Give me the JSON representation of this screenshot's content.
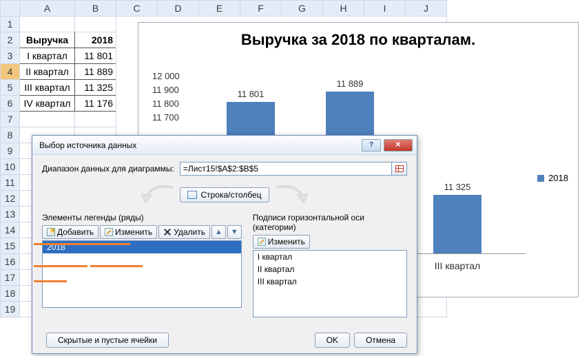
{
  "sheet": {
    "cols": [
      "A",
      "B",
      "C",
      "D",
      "E",
      "F",
      "G",
      "H",
      "I",
      "J"
    ],
    "rows": [
      "1",
      "2",
      "3",
      "4",
      "5",
      "6",
      "7",
      "8",
      "9",
      "10",
      "11",
      "12",
      "13",
      "14",
      "15",
      "16",
      "17",
      "18",
      "19"
    ],
    "header": {
      "a": "Выручка",
      "b": "2018"
    },
    "data": [
      {
        "a": "I квартал",
        "b": "11 801"
      },
      {
        "a": "II квартал",
        "b": "11 889"
      },
      {
        "a": "III квартал",
        "b": "11 325"
      },
      {
        "a": "IV квартал",
        "b": "11 176"
      }
    ],
    "selected_row": 4
  },
  "chart_data": {
    "type": "bar",
    "title": "Выручка за 2018 по кварталам.",
    "categories": [
      "I квартал",
      "II квартал",
      "III квартал",
      "IV квартал"
    ],
    "values": [
      11801,
      11889,
      11325,
      11176
    ],
    "visible_categories": [
      "III квартал"
    ],
    "y_ticks": [
      "12 000",
      "11 900",
      "11 800",
      "11 700"
    ],
    "bar_labels": [
      "11 801",
      "11 889",
      "11 325"
    ],
    "legend": "2018",
    "ylim": [
      11000,
      12000
    ]
  },
  "dialog": {
    "title": "Выбор источника данных",
    "range_label": "Диапазон данных для диаграммы:",
    "range_value": "=Лист15!$A$2:$B$5",
    "swap_label": "Строка/столбец",
    "series_group": "Элементы легенды (ряды)",
    "categories_group": "Подписи горизонтальной оси (категории)",
    "btn_add": "Добавить",
    "btn_edit": "Изменить",
    "btn_delete": "Удалить",
    "btn_edit2": "Изменить",
    "series_items": [
      "2018"
    ],
    "category_items": [
      "I квартал",
      "II квартал",
      "III квартал"
    ],
    "hidden_cells": "Скрытые и пустые ячейки",
    "ok": "OK",
    "cancel": "Отмена"
  }
}
